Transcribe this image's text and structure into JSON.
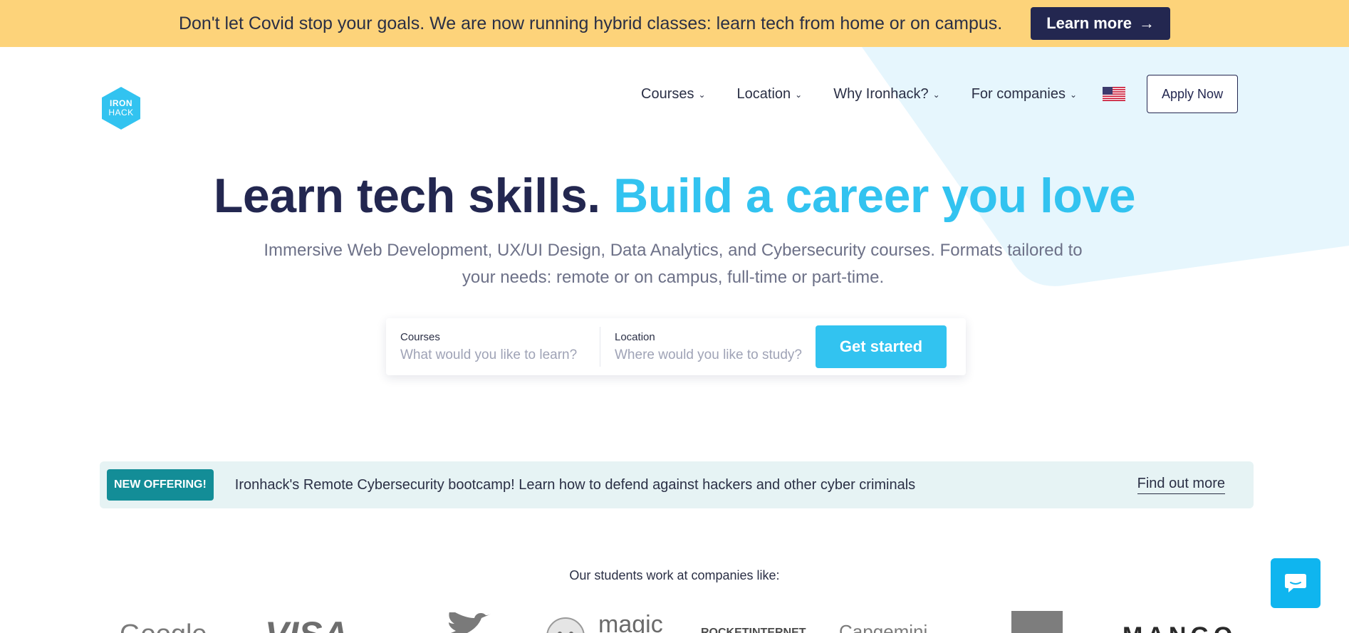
{
  "announcement": {
    "text": "Don't let Covid stop your goals. We are now running hybrid classes: learn tech from home or on campus.",
    "button_label": "Learn more",
    "button_icon": "arrow-right-icon"
  },
  "logo": {
    "line1": "IRON",
    "line2": "HACK"
  },
  "nav": {
    "items": [
      {
        "label": "Courses"
      },
      {
        "label": "Location"
      },
      {
        "label": "Why Ironhack?"
      },
      {
        "label": "For companies"
      }
    ],
    "flag_icon": "us-flag-icon",
    "apply_label": "Apply Now"
  },
  "hero": {
    "title_dark": "Learn tech skills.",
    "title_blue": "Build a career you love",
    "subtitle": "Immersive Web Development, UX/UI Design, Data Analytics, and Cybersecurity courses. Formats tailored to your needs: remote or on campus, full-time or part-time."
  },
  "search": {
    "courses_label": "Courses",
    "courses_placeholder": "What would you like to learn?",
    "location_label": "Location",
    "location_placeholder": "Where would you like to study?",
    "button_label": "Get started"
  },
  "offering": {
    "badge": "NEW OFFERING!",
    "text": "Ironhack's Remote Cybersecurity bootcamp! Learn how to defend against hackers and other cyber criminals",
    "link": "Find out more"
  },
  "companies": {
    "title": "Our students work at companies like:",
    "logos": [
      "Google",
      "VISA",
      "Twitter",
      "magic",
      "ROCKETINTERNET",
      "Capgemini",
      "square",
      "MANGO"
    ]
  },
  "colors": {
    "announcement_bg": "#fdd37a",
    "navy": "#232750",
    "accent_blue": "#32c3f0",
    "offer_bg": "#e6f3f4",
    "badge_teal": "#138d97",
    "chat_blue": "#0fb5ef"
  },
  "chat": {
    "icon": "chat-bubble-icon"
  }
}
